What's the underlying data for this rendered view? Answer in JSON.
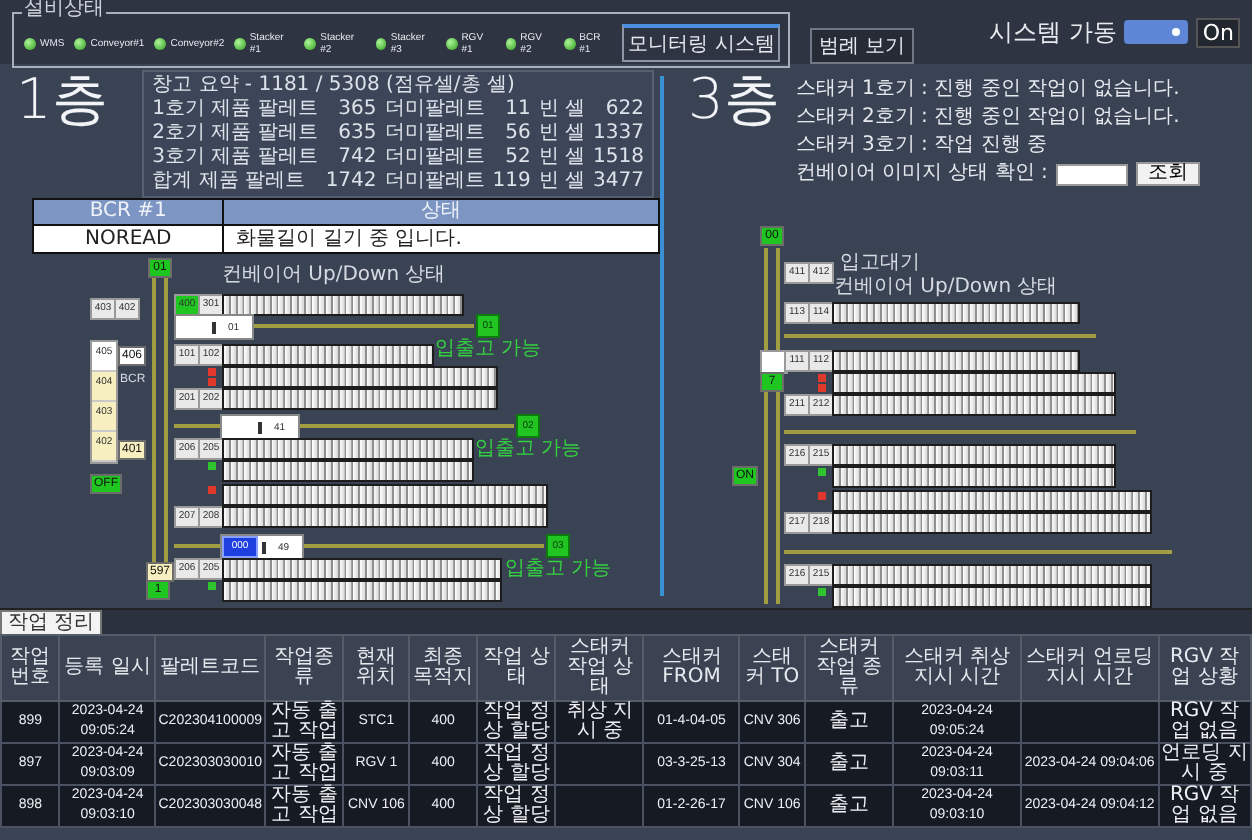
{
  "equipment_status": {
    "title": "설비상태",
    "items": [
      {
        "name": "WMS",
        "on": true
      },
      {
        "name": "Conveyor#1",
        "on": true
      },
      {
        "name": "Conveyor#2",
        "on": true
      },
      {
        "name": "Stacker #1",
        "on": true
      },
      {
        "name": "Stacker #2",
        "on": true
      },
      {
        "name": "Stacker #3",
        "on": true
      },
      {
        "name": "RGV #1",
        "on": true
      },
      {
        "name": "RGV #2",
        "on": true
      },
      {
        "name": "BCR #1",
        "on": true
      }
    ]
  },
  "monitoring_button": "모니터링 시스템",
  "legend_button": "범례 보기",
  "system_run": {
    "label": "시스템 가동",
    "on": true,
    "text": "On"
  },
  "floor_1": {
    "title": "1층",
    "summary": {
      "header": "창고 요약 - 1181 / 5308 (점유셀/총 셀)",
      "rows": [
        [
          "1호기 제품 팔레트",
          "365",
          "더미팔레트",
          "11",
          "빈 셀",
          "622"
        ],
        [
          "2호기 제품 팔레트",
          "635",
          "더미팔레트",
          "56",
          "빈 셀",
          "1337"
        ],
        [
          "3호기 제품 팔레트",
          "742",
          "더미팔레트",
          "52",
          "빈 셀",
          "1518"
        ],
        [
          "합계 제품 팔레트",
          "1742",
          "더미팔레트",
          "119",
          "빈 셀",
          "3477"
        ]
      ]
    },
    "bcr_table": {
      "columns": [
        "BCR #1",
        "상태"
      ],
      "rows": [
        [
          "NOREAD",
          "화물길이 길기 중 입니다."
        ]
      ]
    },
    "diagram": [
      {
        "kind": "badge",
        "text": "01",
        "color": "#1fc61f"
      },
      {
        "kind": "shaft"
      },
      {
        "kind": "note",
        "text": "컨베이어 Up/Down 상태"
      },
      {
        "kind": "rack",
        "labels": [
          "400",
          "301"
        ],
        "first_label_active": true
      },
      {
        "kind": "rail",
        "number": "01",
        "station": "01"
      },
      {
        "kind": "rack",
        "labels": [
          "101",
          "102"
        ],
        "first_label_active": false
      },
      {
        "kind": "status",
        "text": "입출고 가능"
      },
      {
        "kind": "rack",
        "labels": [
          "201",
          "202"
        ],
        "first_label_active": false,
        "double": true,
        "labels_below": true,
        "sensors": [
          {
            "color": "#e0392b"
          },
          {
            "color": "#e0392b"
          }
        ]
      },
      {
        "kind": "rail",
        "number": "41",
        "station": "02"
      },
      {
        "kind": "rack",
        "labels": [
          "206",
          "205"
        ],
        "first_label_active": false,
        "double": true,
        "labels_below": false,
        "sensors": [
          {
            "color": "#2fc42f"
          }
        ]
      },
      {
        "kind": "status",
        "text": "입출고 가능"
      },
      {
        "kind": "rack",
        "labels": [
          "207",
          "208"
        ],
        "first_label_active": false,
        "double": true,
        "labels_below": true,
        "sensors": [
          {
            "color": "#e0392b"
          }
        ]
      },
      {
        "kind": "rail",
        "tag": "000",
        "number": "49",
        "station": "03"
      },
      {
        "kind": "rack",
        "labels": [
          "206",
          "205"
        ],
        "first_label_active": false,
        "double": true,
        "labels_below": false,
        "sensors": [
          {
            "color": "#2fc42f"
          }
        ]
      },
      {
        "kind": "status",
        "text": "입출고 가능"
      },
      {
        "kind": "labels",
        "labels": [
          "403",
          "402"
        ]
      },
      {
        "kind": "stack",
        "cells": [
          {
            "text": "405",
            "color": "#ffffff"
          },
          {
            "text": "404",
            "color": "#f7efbf"
          },
          {
            "text": "403",
            "color": "#f7efbf"
          },
          {
            "text": "402",
            "color": "#f7efbf"
          }
        ]
      },
      {
        "kind": "badge",
        "text": "406",
        "color": "#ffffff"
      },
      {
        "kind": "label",
        "text": "BCR"
      },
      {
        "kind": "badge",
        "text": "401",
        "color": "#f7efbf"
      },
      {
        "kind": "badge",
        "text": "OFF",
        "color": "#1fc61f"
      },
      {
        "kind": "badge",
        "text": "597",
        "color": "#f7efbf"
      },
      {
        "kind": "badge",
        "text": "1",
        "color": "#1fc61f"
      }
    ]
  },
  "floor_3": {
    "title": "3층",
    "messages": [
      "스태커 1호기 : 진행 중인 작업이 없습니다.",
      "스태커 2호기 : 진행 중인 작업이 없습니다.",
      "스태커 3호기 : 작업 진행 중"
    ],
    "conveyor_check": {
      "label": "컨베이어 이미지 상태 확인 :",
      "button": "조회"
    },
    "diagram": [
      {
        "kind": "badge",
        "text": "00",
        "color": "#1fc61f"
      },
      {
        "kind": "shaft"
      },
      {
        "kind": "labels",
        "labels": [
          "411",
          "412"
        ]
      },
      {
        "kind": "note",
        "text": "입고대기"
      },
      {
        "kind": "note",
        "text": "컨베이어 Up/Down 상태"
      },
      {
        "kind": "rack",
        "labels": [
          "113",
          "114"
        ],
        "first_label_active": false
      },
      {
        "kind": "rail"
      },
      {
        "kind": "car"
      },
      {
        "kind": "badge",
        "text": "7",
        "color": "#1fc61f"
      },
      {
        "kind": "rack",
        "labels": [
          "111",
          "112"
        ],
        "first_label_active": false
      },
      {
        "kind": "rack",
        "labels": [
          "211",
          "212"
        ],
        "first_label_active": false,
        "double": true,
        "labels_below": true,
        "sensors": [
          {
            "color": "#e0392b"
          },
          {
            "color": "#e0392b"
          }
        ]
      },
      {
        "kind": "rail"
      },
      {
        "kind": "rack",
        "labels": [
          "216",
          "215"
        ],
        "first_label_active": false,
        "double": true,
        "labels_below": false,
        "sensors": [
          {
            "color": "#2fc42f"
          }
        ]
      },
      {
        "kind": "badge",
        "text": "ON",
        "color": "#1fc61f"
      },
      {
        "kind": "rack",
        "labels": [
          "217",
          "218"
        ],
        "first_label_active": false,
        "double": true,
        "labels_below": true,
        "sensors": [
          {
            "color": "#e0392b"
          }
        ]
      },
      {
        "kind": "rail"
      },
      {
        "kind": "rack",
        "labels": [
          "216",
          "215"
        ],
        "first_label_active": false,
        "double": true,
        "labels_below": false,
        "sensors": [
          {
            "color": "#2fc42f"
          }
        ]
      }
    ]
  },
  "work_tab": {
    "label": "작업 정리",
    "selected": true
  },
  "work_table": {
    "columns": [
      "작업 번호",
      "등록 일시",
      "팔레트코드",
      "작업종류",
      "현재 위치",
      "최종 목적지",
      "작업 상태",
      "스태커 작업 상태",
      "스태커 FROM",
      "스태커 TO",
      "스태커 작업 종류",
      "스태커 취상 지시 시간",
      "스태커 언로딩 지시 시간",
      "RGV 작업 상황"
    ],
    "rows": [
      [
        "899",
        "2023-04-24 09:05:24",
        "C202304100009",
        "자동 출고 작업",
        "STC1",
        "400",
        "작업 정상 할당",
        "취상 지시 중",
        "01-4-04-05",
        "CNV 306",
        "출고",
        "2023-04-24 09:05:24",
        null,
        "RGV 작업 없음"
      ],
      [
        "897",
        "2023-04-24 09:03:09",
        "C202303030010",
        "자동 출고 작업",
        "RGV 1",
        "400",
        "작업 정상 할당",
        null,
        "03-3-25-13",
        "CNV 304",
        "출고",
        "2023-04-24 09:03:11",
        "2023-04-24 09:04:06",
        "언로딩 지시 중"
      ],
      [
        "898",
        "2023-04-24 09:03:10",
        "C202303030048",
        "자동 출고 작업",
        "CNV 106",
        "400",
        "작업 정상 할당",
        null,
        "01-2-26-17",
        "CNV 106",
        "출고",
        "2023-04-24 09:03:10",
        "2023-04-24 09:04:12",
        "RGV 작업 없음"
      ]
    ]
  }
}
